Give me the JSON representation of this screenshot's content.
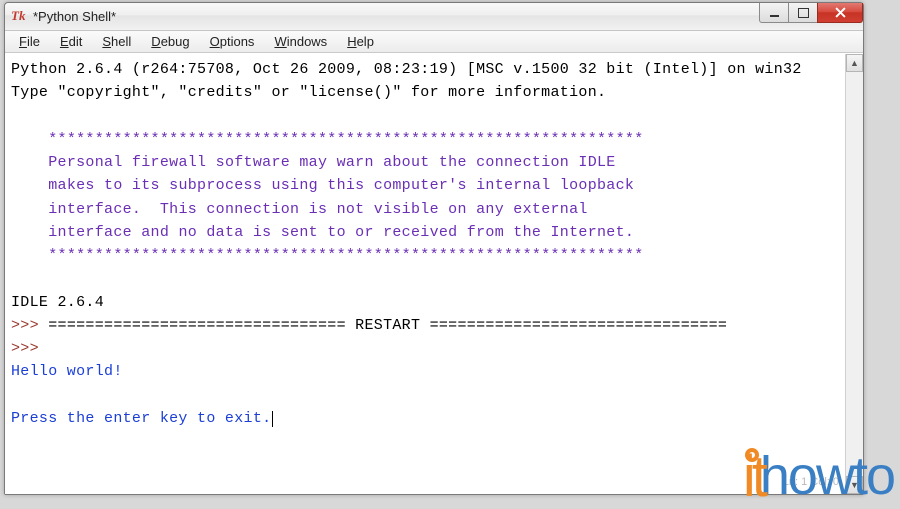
{
  "window": {
    "title": "*Python Shell*",
    "app_icon_text": "Tk"
  },
  "menubar": {
    "items": [
      {
        "label": "File",
        "accel": "F",
        "rest": "ile"
      },
      {
        "label": "Edit",
        "accel": "E",
        "rest": "dit"
      },
      {
        "label": "Shell",
        "accel": "S",
        "rest": "hell"
      },
      {
        "label": "Debug",
        "accel": "D",
        "rest": "ebug"
      },
      {
        "label": "Options",
        "accel": "O",
        "rest": "ptions"
      },
      {
        "label": "Windows",
        "accel": "W",
        "rest": "indows"
      },
      {
        "label": "Help",
        "accel": "H",
        "rest": "elp"
      }
    ]
  },
  "console": {
    "banner_line1": "Python 2.6.4 (r264:75708, Oct 26 2009, 08:23:19) [MSC v.1500 32 bit (Intel)] on win32",
    "banner_line2": "Type \"copyright\", \"credits\" or \"license()\" for more information.",
    "firewall_border": "    ****************************************************************",
    "firewall_l1": "    Personal firewall software may warn about the connection IDLE",
    "firewall_l2": "    makes to its subprocess using this computer's internal loopback",
    "firewall_l3": "    interface.  This connection is not visible on any external",
    "firewall_l4": "    interface and no data is sent to or received from the Internet.",
    "idle_version": "IDLE 2.6.4",
    "prompt": ">>> ",
    "restart_line": "================================ RESTART ================================",
    "output_hello": "Hello world!",
    "output_prompt": "Press the enter key to exit."
  },
  "status": {
    "position": "Ln: 1  Col: 0"
  },
  "watermark": {
    "part1": "it",
    "part2": "howto"
  }
}
